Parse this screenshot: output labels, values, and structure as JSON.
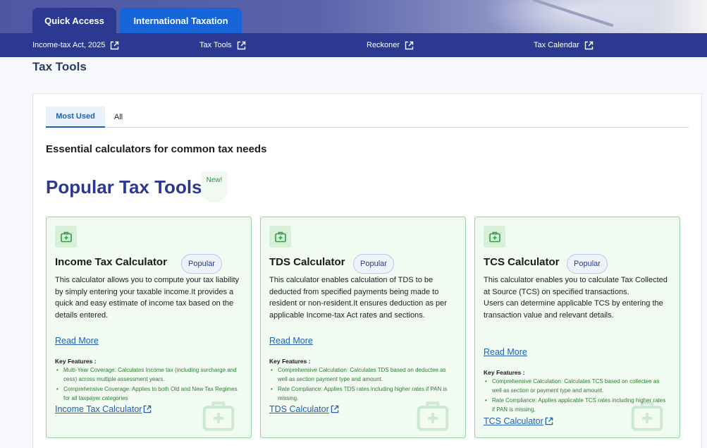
{
  "top_tabs": {
    "quick_access": "Quick Access",
    "international": "International Taxation"
  },
  "nav": [
    {
      "label": "Income-tax Act, 2025"
    },
    {
      "label": "Tax Tools"
    },
    {
      "label": "Reckoner"
    },
    {
      "label": "Tax Calendar"
    }
  ],
  "page": {
    "title": "Tax Tools"
  },
  "tabs": {
    "most_used": "Most Used",
    "all": "All"
  },
  "main": {
    "subheading": "Essential calculators for common tax needs",
    "section_title": "Popular Tax Tools",
    "new_badge": "New!"
  },
  "cards": [
    {
      "title": "Income Tax Calculator",
      "badge": "Popular",
      "description": "This calculator allows you to compute your tax liability by simply entering your taxable income.It provides a quick and easy estimate of income tax based on the details entered.",
      "read_more": "Read More",
      "key_features_label": "Key Features :",
      "features": [
        "Multi-Year Coverage: Calculates Income tax (including surcharge and cess) across multiple assessment years.",
        "Comprehensive Coverage: Applies to both Old and New Tax Regimes for all taxpayer categories"
      ],
      "link": "Income Tax Calculator"
    },
    {
      "title": "TDS Calculator",
      "badge": "Popular",
      "description": "This calculator enables calculation of TDS to be deducted from specified payments being made to resident or non-resident.It ensures deduction as per applicable Income-tax Act rates and sections.",
      "read_more": "Read More",
      "key_features_label": "Key Features :",
      "features": [
        "Comprehensive Calculation: Calculates TDS based on deductee as well as section payment type and amount.",
        "Rate Compliance: Applies TDS rates including higher rates if PAN is missing."
      ],
      "link": "TDS Calculator"
    },
    {
      "title": "TCS Calculator",
      "badge": "Popular",
      "description": "This calculator enables you to calculate Tax Collected at Source (TCS) on specified transactions.\nUsers can determine applicable TCS by entering the transaction value and relevant details.",
      "read_more": "Read More",
      "key_features_label": "Key Features :",
      "features": [
        "Comprehensive Calculation: Calculates TCS based on collectee as well as section or payment type and amount.",
        "Rate Compliance: Applies applicable TCS rates including higher rates if PAN is missing."
      ],
      "link": "TCS Calculator"
    }
  ],
  "icons": {
    "card_icon": "medical-kit-icon",
    "external_link": "external-link-icon"
  },
  "colors": {
    "brand_navy": "#2b3990",
    "accent_blue": "#1565d8",
    "card_bg": "#f1fbf1",
    "card_border": "#8dd39a",
    "feature_text": "#2e7d32"
  }
}
